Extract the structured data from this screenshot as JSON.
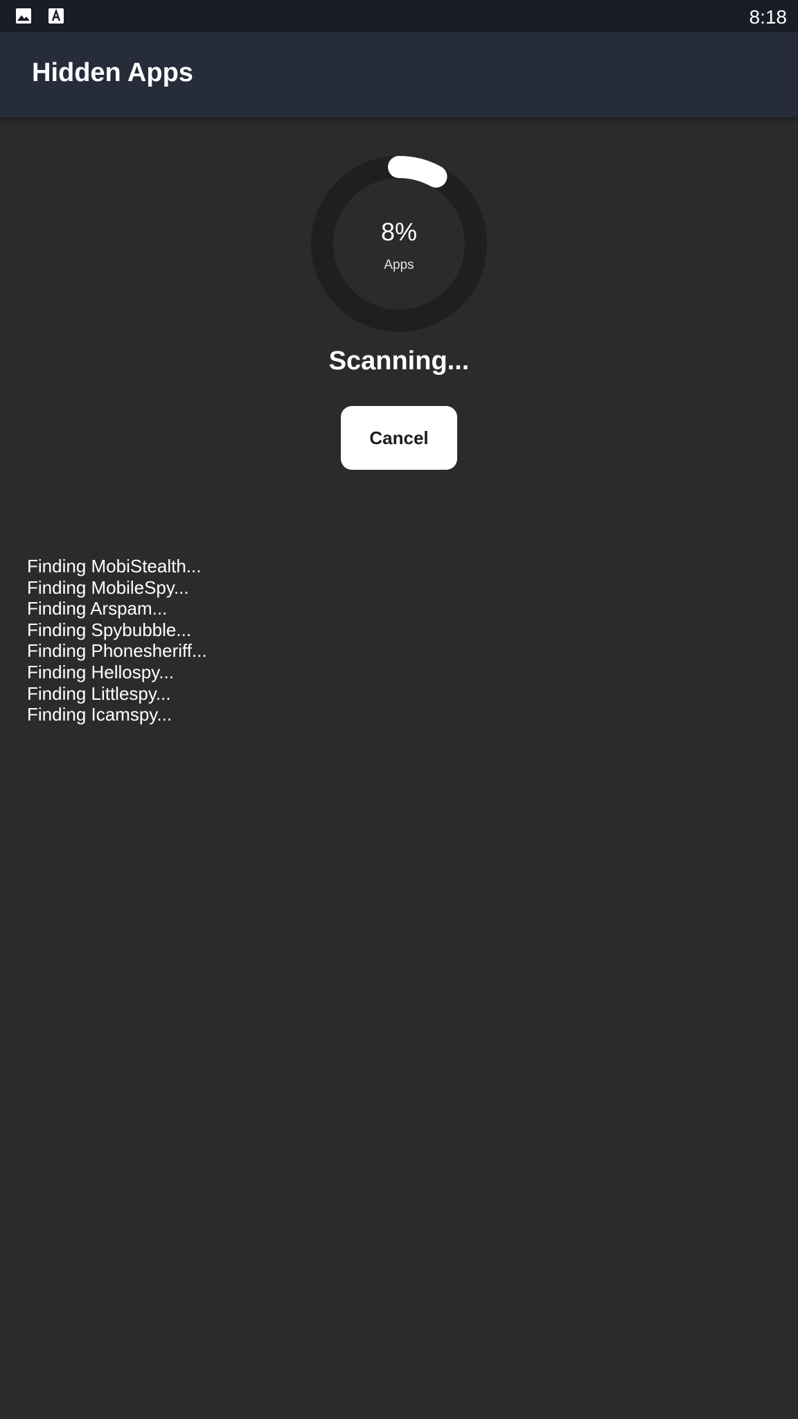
{
  "status_bar": {
    "time": "8:18",
    "icons": [
      "gallery-icon",
      "font-a-icon"
    ]
  },
  "app_bar": {
    "title": "Hidden Apps"
  },
  "progress": {
    "percent_text": "8%",
    "label": "Apps",
    "value": 0.08,
    "track_color": "#1f1f1f",
    "fill_color": "#ffffff"
  },
  "scan": {
    "status_text": "Scanning...",
    "cancel_label": "Cancel"
  },
  "log": [
    "Finding MobiStealth...",
    "Finding MobileSpy...",
    "Finding Arspam...",
    "Finding Spybubble...",
    "Finding Phonesheriff...",
    "Finding Hellospy...",
    "Finding Littlespy...",
    "Finding Icamspy..."
  ]
}
